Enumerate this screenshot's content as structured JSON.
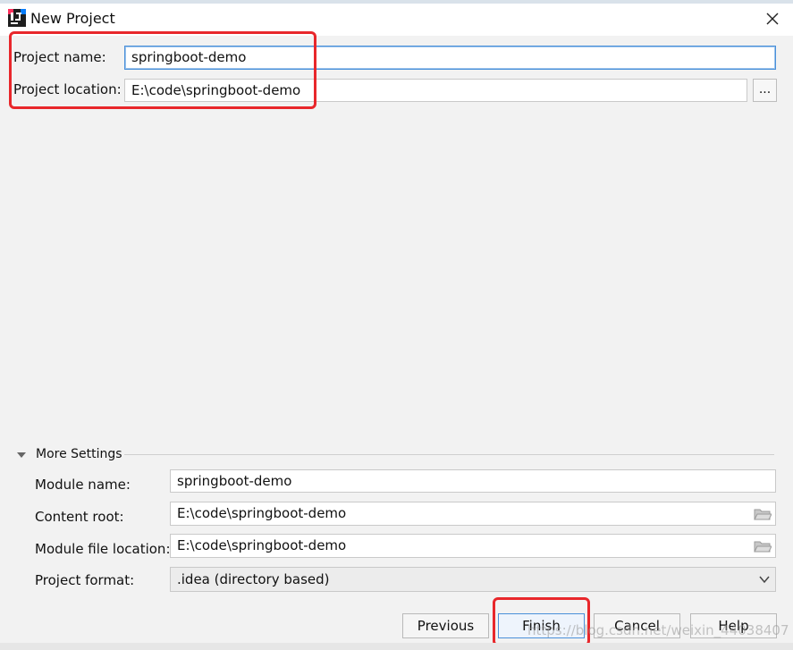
{
  "window": {
    "title": "New Project",
    "app_icon": "intellij-idea-icon",
    "close_icon": "close-icon"
  },
  "form": {
    "project_name_label": "Project name:",
    "project_name_value": "springboot-demo",
    "project_location_label": "Project location:",
    "project_location_value": "E:\\code\\springboot-demo",
    "browse_label": "..."
  },
  "more_settings": {
    "title": "More Settings",
    "expanded_icon": "triangle-down-icon",
    "module_name_label": "Module name:",
    "module_name_value": "springboot-demo",
    "content_root_label": "Content root:",
    "content_root_value": "E:\\code\\springboot-demo",
    "module_file_location_label": "Module file location:",
    "module_file_location_value": "E:\\code\\springboot-demo",
    "project_format_label": "Project format:",
    "project_format_value": ".idea (directory based)"
  },
  "buttons": {
    "previous": "Previous",
    "finish": "Finish",
    "cancel": "Cancel",
    "help": "Help"
  },
  "watermark": "https://blog.csdn.net/weixin_44038407",
  "colors": {
    "highlight": "#e8272b",
    "focus": "#4a90d9"
  }
}
